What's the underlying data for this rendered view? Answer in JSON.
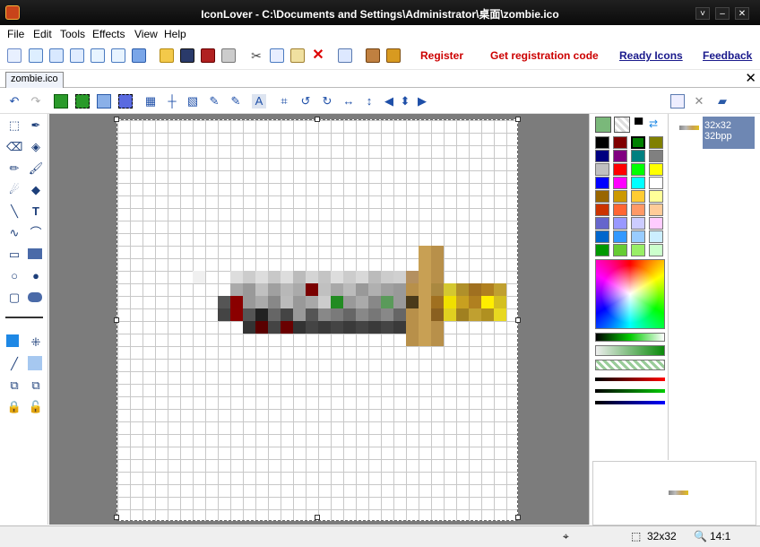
{
  "window": {
    "title": "IconLover - C:\\Documents and Settings\\Administrator\\桌面\\zombie.ico",
    "controls": [
      "˅",
      "–",
      "✕"
    ]
  },
  "menu": [
    "File",
    "Edit",
    "Tools",
    "Effects",
    "View",
    "Help"
  ],
  "toolbar": {
    "links": {
      "register": "Register",
      "get_code": "Get registration code",
      "ready_icons": "Ready Icons",
      "feedback": "Feedback"
    }
  },
  "document": {
    "tab_label": "zombie.ico",
    "close_symbol": "✕"
  },
  "edit_toolbar_icons": [
    "undo-icon",
    "redo-icon",
    "select-all-icon",
    "crop-icon",
    "3d-box-icon",
    "selection-frame-icon",
    "grid-icon",
    "crosshair-icon",
    "hatch-icon",
    "picker-plus-icon",
    "picker-minus-icon",
    "text-mode-icon",
    "crop-tool-icon",
    "rotate-left-icon",
    "rotate-right-icon",
    "flip-horizontal-icon",
    "flip-vertical-icon",
    "move-left-icon",
    "move-updown-icon",
    "move-right-icon"
  ],
  "tools": [
    "rect-select",
    "eyedropper",
    "eraser",
    "clear",
    "pencil",
    "brush",
    "airbrush",
    "fill",
    "line",
    "text",
    "curve",
    "arc",
    "rectangle",
    "filled-rectangle",
    "ellipse",
    "filled-ellipse",
    "rounded-rect",
    "filled-rounded-rect"
  ],
  "palette": {
    "colors": [
      [
        "#000000",
        "#800000",
        "#008000",
        "#808000"
      ],
      [
        "#000080",
        "#800080",
        "#008080",
        "#808080"
      ],
      [
        "#c0c0c0",
        "#ff0000",
        "#00ff00",
        "#ffff00"
      ],
      [
        "#0000ff",
        "#ff00ff",
        "#00ffff",
        "#ffffff"
      ],
      [
        "#996600",
        "#cc9900",
        "#ffcc33",
        "#ffff99"
      ],
      [
        "#cc3300",
        "#ff6633",
        "#ff9966",
        "#ffcc99"
      ],
      [
        "#6666cc",
        "#9999ff",
        "#ccccff",
        "#ffccff"
      ],
      [
        "#0066cc",
        "#3399ff",
        "#99ccff",
        "#cceeff"
      ],
      [
        "#009900",
        "#66cc33",
        "#99ee66",
        "#ccffcc"
      ]
    ],
    "current_color": "#008000"
  },
  "thumbnail": {
    "size": "32x32",
    "depth": "32bpp"
  },
  "status": {
    "image_size": "32x32",
    "zoom": "14:1"
  },
  "sword_pixels": [
    {
      "c": 24,
      "r": 10,
      "color": "#c8a054"
    },
    {
      "c": 25,
      "r": 10,
      "color": "#b8904a"
    },
    {
      "c": 24,
      "r": 11,
      "color": "#c8a054"
    },
    {
      "c": 25,
      "r": 11,
      "color": "#b8904a"
    },
    {
      "c": 6,
      "r": 12,
      "color": "#f0f0f0"
    },
    {
      "c": 9,
      "r": 12,
      "color": "#dddddd"
    },
    {
      "c": 10,
      "r": 12,
      "color": "#cccccc"
    },
    {
      "c": 11,
      "r": 12,
      "color": "#dddddd"
    },
    {
      "c": 12,
      "r": 12,
      "color": "#c8c8c8"
    },
    {
      "c": 13,
      "r": 12,
      "color": "#dddddd"
    },
    {
      "c": 14,
      "r": 12,
      "color": "#bbbbbb"
    },
    {
      "c": 15,
      "r": 12,
      "color": "#d4d4d4"
    },
    {
      "c": 16,
      "r": 12,
      "color": "#c4c4c4"
    },
    {
      "c": 17,
      "r": 12,
      "color": "#dddddd"
    },
    {
      "c": 18,
      "r": 12,
      "color": "#cccccc"
    },
    {
      "c": 19,
      "r": 12,
      "color": "#d8d8d8"
    },
    {
      "c": 20,
      "r": 12,
      "color": "#bbbbbb"
    },
    {
      "c": 21,
      "r": 12,
      "color": "#cccccc"
    },
    {
      "c": 22,
      "r": 12,
      "color": "#d0d0d0"
    },
    {
      "c": 23,
      "r": 12,
      "color": "#b49060"
    },
    {
      "c": 24,
      "r": 12,
      "color": "#c8a054"
    },
    {
      "c": 25,
      "r": 12,
      "color": "#b8904a"
    },
    {
      "c": 9,
      "r": 13,
      "color": "#aaaaaa"
    },
    {
      "c": 10,
      "r": 13,
      "color": "#999999"
    },
    {
      "c": 11,
      "r": 13,
      "color": "#c0c0c0"
    },
    {
      "c": 12,
      "r": 13,
      "color": "#a0a0a0"
    },
    {
      "c": 13,
      "r": 13,
      "color": "#b8b8b8"
    },
    {
      "c": 14,
      "r": 13,
      "color": "#aaaaaa"
    },
    {
      "c": 15,
      "r": 13,
      "color": "#7a0000"
    },
    {
      "c": 16,
      "r": 13,
      "color": "#c0c0c0"
    },
    {
      "c": 17,
      "r": 13,
      "color": "#a8a8a8"
    },
    {
      "c": 18,
      "r": 13,
      "color": "#bbbbbb"
    },
    {
      "c": 19,
      "r": 13,
      "color": "#999999"
    },
    {
      "c": 20,
      "r": 13,
      "color": "#b0b0b0"
    },
    {
      "c": 21,
      "r": 13,
      "color": "#a0a0a0"
    },
    {
      "c": 22,
      "r": 13,
      "color": "#999999"
    },
    {
      "c": 23,
      "r": 13,
      "color": "#b8904a"
    },
    {
      "c": 24,
      "r": 13,
      "color": "#c8a054"
    },
    {
      "c": 25,
      "r": 13,
      "color": "#aa8840"
    },
    {
      "c": 26,
      "r": 13,
      "color": "#d4c830"
    },
    {
      "c": 27,
      "r": 13,
      "color": "#b0902a"
    },
    {
      "c": 28,
      "r": 13,
      "color": "#a07020"
    },
    {
      "c": 29,
      "r": 13,
      "color": "#b08020"
    },
    {
      "c": 30,
      "r": 13,
      "color": "#c0a030"
    },
    {
      "c": 8,
      "r": 14,
      "color": "#555555"
    },
    {
      "c": 9,
      "r": 14,
      "color": "#8a0000"
    },
    {
      "c": 10,
      "r": 14,
      "color": "#999999"
    },
    {
      "c": 11,
      "r": 14,
      "color": "#aaaaaa"
    },
    {
      "c": 12,
      "r": 14,
      "color": "#888888"
    },
    {
      "c": 13,
      "r": 14,
      "color": "#bbbbbb"
    },
    {
      "c": 14,
      "r": 14,
      "color": "#999999"
    },
    {
      "c": 15,
      "r": 14,
      "color": "#a8a8a8"
    },
    {
      "c": 16,
      "r": 14,
      "color": "#cccccc"
    },
    {
      "c": 17,
      "r": 14,
      "color": "#228b22"
    },
    {
      "c": 18,
      "r": 14,
      "color": "#999999"
    },
    {
      "c": 19,
      "r": 14,
      "color": "#aaaaaa"
    },
    {
      "c": 20,
      "r": 14,
      "color": "#888888"
    },
    {
      "c": 21,
      "r": 14,
      "color": "#5a9a5a"
    },
    {
      "c": 22,
      "r": 14,
      "color": "#999999"
    },
    {
      "c": 23,
      "r": 14,
      "color": "#4a3a1a"
    },
    {
      "c": 24,
      "r": 14,
      "color": "#c8a054"
    },
    {
      "c": 25,
      "r": 14,
      "color": "#a07020"
    },
    {
      "c": 26,
      "r": 14,
      "color": "#f0e000"
    },
    {
      "c": 27,
      "r": 14,
      "color": "#c8a020"
    },
    {
      "c": 28,
      "r": 14,
      "color": "#b08020"
    },
    {
      "c": 29,
      "r": 14,
      "color": "#ffee00"
    },
    {
      "c": 30,
      "r": 14,
      "color": "#d4c020"
    },
    {
      "c": 8,
      "r": 15,
      "color": "#444444"
    },
    {
      "c": 9,
      "r": 15,
      "color": "#8b0000"
    },
    {
      "c": 10,
      "r": 15,
      "color": "#555555"
    },
    {
      "c": 11,
      "r": 15,
      "color": "#222222"
    },
    {
      "c": 12,
      "r": 15,
      "color": "#666666"
    },
    {
      "c": 13,
      "r": 15,
      "color": "#444444"
    },
    {
      "c": 14,
      "r": 15,
      "color": "#999999"
    },
    {
      "c": 15,
      "r": 15,
      "color": "#555555"
    },
    {
      "c": 16,
      "r": 15,
      "color": "#888888"
    },
    {
      "c": 17,
      "r": 15,
      "color": "#7a7a7a"
    },
    {
      "c": 18,
      "r": 15,
      "color": "#666666"
    },
    {
      "c": 19,
      "r": 15,
      "color": "#888888"
    },
    {
      "c": 20,
      "r": 15,
      "color": "#777777"
    },
    {
      "c": 21,
      "r": 15,
      "color": "#888888"
    },
    {
      "c": 22,
      "r": 15,
      "color": "#666666"
    },
    {
      "c": 23,
      "r": 15,
      "color": "#b8904a"
    },
    {
      "c": 24,
      "r": 15,
      "color": "#c8a054"
    },
    {
      "c": 25,
      "r": 15,
      "color": "#8a6020"
    },
    {
      "c": 26,
      "r": 15,
      "color": "#e0d020"
    },
    {
      "c": 27,
      "r": 15,
      "color": "#a08020"
    },
    {
      "c": 28,
      "r": 15,
      "color": "#c0a030"
    },
    {
      "c": 29,
      "r": 15,
      "color": "#b09020"
    },
    {
      "c": 30,
      "r": 15,
      "color": "#e8d820"
    },
    {
      "c": 10,
      "r": 16,
      "color": "#333333"
    },
    {
      "c": 11,
      "r": 16,
      "color": "#5a0000"
    },
    {
      "c": 12,
      "r": 16,
      "color": "#444444"
    },
    {
      "c": 13,
      "r": 16,
      "color": "#6a0000"
    },
    {
      "c": 14,
      "r": 16,
      "color": "#333333"
    },
    {
      "c": 15,
      "r": 16,
      "color": "#444444"
    },
    {
      "c": 16,
      "r": 16,
      "color": "#3a3a3a"
    },
    {
      "c": 17,
      "r": 16,
      "color": "#444444"
    },
    {
      "c": 18,
      "r": 16,
      "color": "#3a3a3a"
    },
    {
      "c": 19,
      "r": 16,
      "color": "#444444"
    },
    {
      "c": 20,
      "r": 16,
      "color": "#3a3a3a"
    },
    {
      "c": 21,
      "r": 16,
      "color": "#444444"
    },
    {
      "c": 22,
      "r": 16,
      "color": "#3a3a3a"
    },
    {
      "c": 23,
      "r": 16,
      "color": "#b8904a"
    },
    {
      "c": 24,
      "r": 16,
      "color": "#c8a054"
    },
    {
      "c": 25,
      "r": 16,
      "color": "#b8904a"
    },
    {
      "c": 23,
      "r": 17,
      "color": "#b8904a"
    },
    {
      "c": 24,
      "r": 17,
      "color": "#c8a054"
    },
    {
      "c": 25,
      "r": 17,
      "color": "#b8904a"
    }
  ]
}
